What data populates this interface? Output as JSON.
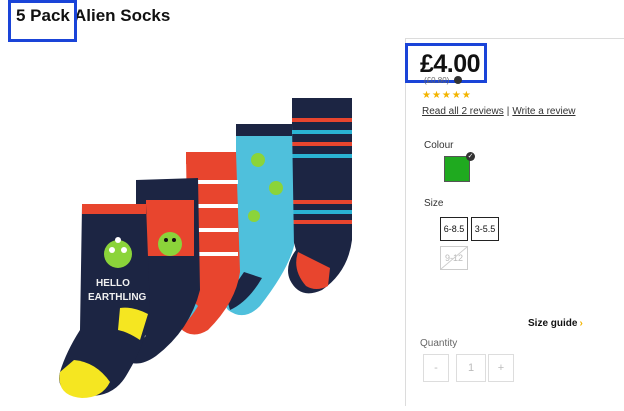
{
  "product": {
    "title": "5 Pack Alien Socks",
    "price": "£4.00",
    "unit_price": "(£0.80)",
    "rating_stars": "★★★★★",
    "rating_value": 5,
    "reviews_link": "Read all 2 reviews",
    "reviews_separator": "|",
    "write_review_link": "Write a review",
    "sock_print_line1": "HELLO",
    "sock_print_line2": "EARTHLING"
  },
  "colour": {
    "label": "Colour",
    "selected_color": "#1faa1f"
  },
  "size": {
    "label": "Size",
    "options": [
      "6-8.5",
      "3-5.5",
      "9-12"
    ],
    "disabled": [
      "9-12"
    ]
  },
  "size_guide": {
    "label": "Size guide",
    "chevron": "›"
  },
  "quantity": {
    "label": "Quantity",
    "minus": "-",
    "value": "1",
    "plus": "+"
  }
}
